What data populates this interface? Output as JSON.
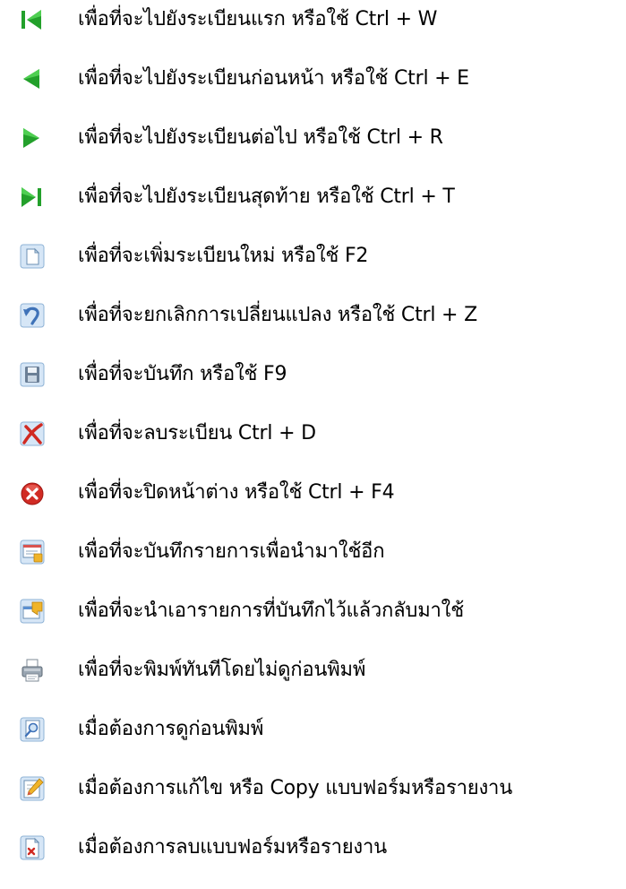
{
  "items": [
    {
      "icon": "first-record-icon",
      "text": "เพื่อที่จะไปยังระเบียนแรก หรือใช้ Ctrl + W"
    },
    {
      "icon": "previous-record-icon",
      "text": "เพื่อที่จะไปยังระเบียนก่อนหน้า หรือใช้ Ctrl + E"
    },
    {
      "icon": "next-record-icon",
      "text": "เพื่อที่จะไปยังระเบียนต่อไป หรือใช้ Ctrl + R"
    },
    {
      "icon": "last-record-icon",
      "text": "เพื่อที่จะไปยังระเบียนสุดท้าย หรือใช้ Ctrl + T"
    },
    {
      "icon": "new-record-icon",
      "text": "เพื่อที่จะเพิ่มระเบียนใหม่ หรือใช้ F2"
    },
    {
      "icon": "undo-icon",
      "text": "เพื่อที่จะยกเลิกการเปลี่ยนแปลง หรือใช้ Ctrl + Z"
    },
    {
      "icon": "save-icon",
      "text": "เพื่อที่จะบันทึก หรือใช้ F9"
    },
    {
      "icon": "delete-record-icon",
      "text": "เพื่อที่จะลบระเบียน  Ctrl + D"
    },
    {
      "icon": "close-window-icon",
      "text": "เพื่อที่จะปิดหน้าต่าง หรือใช้ Ctrl + F4"
    },
    {
      "icon": "save-template-icon",
      "text": "เพื่อที่จะบันทึกรายการเพื่อนำมาใช้อีก"
    },
    {
      "icon": "load-template-icon",
      "text": "เพื่อที่จะนำเอารายการที่บันทึกไว้แล้วกลับมาใช้"
    },
    {
      "icon": "print-icon",
      "text": "เพื่อที่จะพิมพ์ทันทีโดยไม่ดูก่อนพิมพ์"
    },
    {
      "icon": "print-preview-icon",
      "text": "เมื่อต้องการดูก่อนพิมพ์"
    },
    {
      "icon": "edit-form-icon",
      "text": "เมื่อต้องการแก้ไข หรือ Copy แบบฟอร์มหรือรายงาน"
    },
    {
      "icon": "delete-form-icon",
      "text": "เมื่อต้องการลบแบบฟอร์มหรือรายงาน"
    }
  ]
}
